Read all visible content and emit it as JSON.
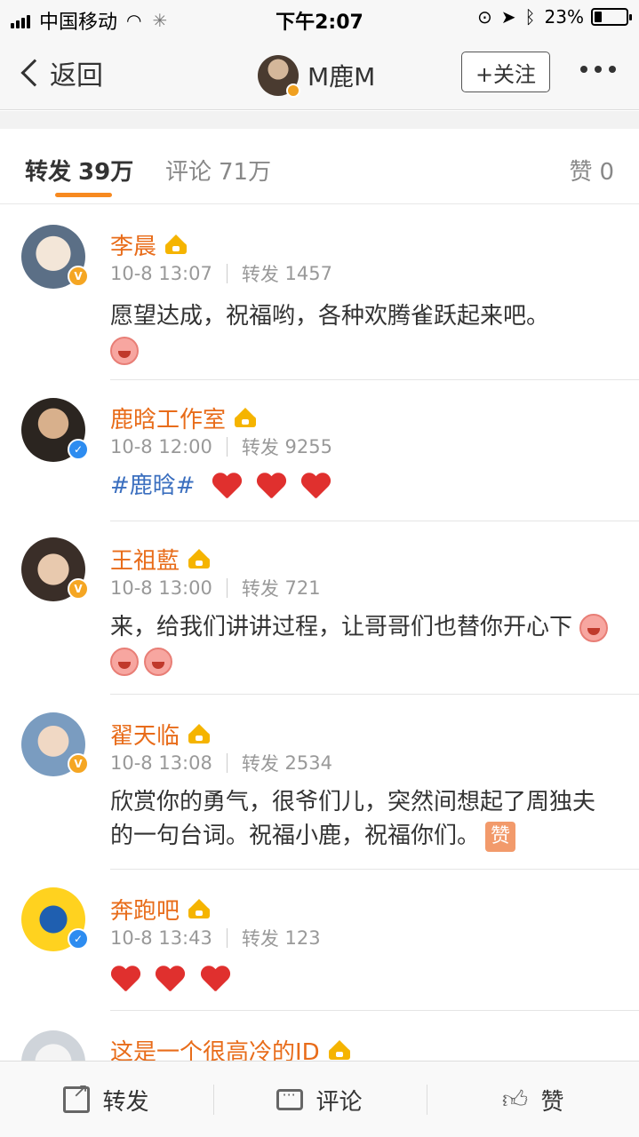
{
  "status_bar": {
    "carrier": "中国移动",
    "time": "下午2:07",
    "battery_percent": "23%",
    "battery_level": 0.23
  },
  "nav": {
    "back_label": "返回",
    "title": "M鹿M",
    "follow_label": "+关注"
  },
  "tabs": [
    {
      "label": "转发",
      "count": "39万"
    },
    {
      "label": "评论",
      "count": "71万"
    },
    {
      "label": "赞",
      "count": "0"
    }
  ],
  "reposts": [
    {
      "name": "李晨",
      "date": "10-8 13:07",
      "repost_label": "转发",
      "repost_count": "1457",
      "text": "愿望达成，祝福哟，各种欢腾雀跃起来吧。",
      "badge": "orange"
    },
    {
      "name": "鹿晗工作室",
      "date": "10-8 12:00",
      "repost_label": "转发",
      "repost_count": "9255",
      "topic": "#鹿晗#",
      "badge": "blue"
    },
    {
      "name": "王祖藍",
      "date": "10-8 13:00",
      "repost_label": "转发",
      "repost_count": "721",
      "text": "来，给我们讲讲过程，让哥哥们也替你开心下",
      "badge": "orange"
    },
    {
      "name": "翟天临",
      "date": "10-8 13:08",
      "repost_label": "转发",
      "repost_count": "2534",
      "text": "欣赏你的勇气，很爷们儿，突然间想起了周独夫的一句台词。祝福小鹿，祝福你们。",
      "stamp": "赞",
      "badge": "orange"
    },
    {
      "name": "奔跑吧",
      "date": "10-8 13:43",
      "repost_label": "转发",
      "repost_count": "123",
      "badge": "blue"
    },
    {
      "name": "这是一个很高冷的ID"
    }
  ],
  "actions": {
    "repost_label": "转发",
    "comment_label": "评论",
    "like_label": "赞"
  },
  "colors": {
    "accent": "#f7891f",
    "username": "#e86c1a",
    "topic": "#3b6fbf",
    "heart": "#e0302e"
  }
}
